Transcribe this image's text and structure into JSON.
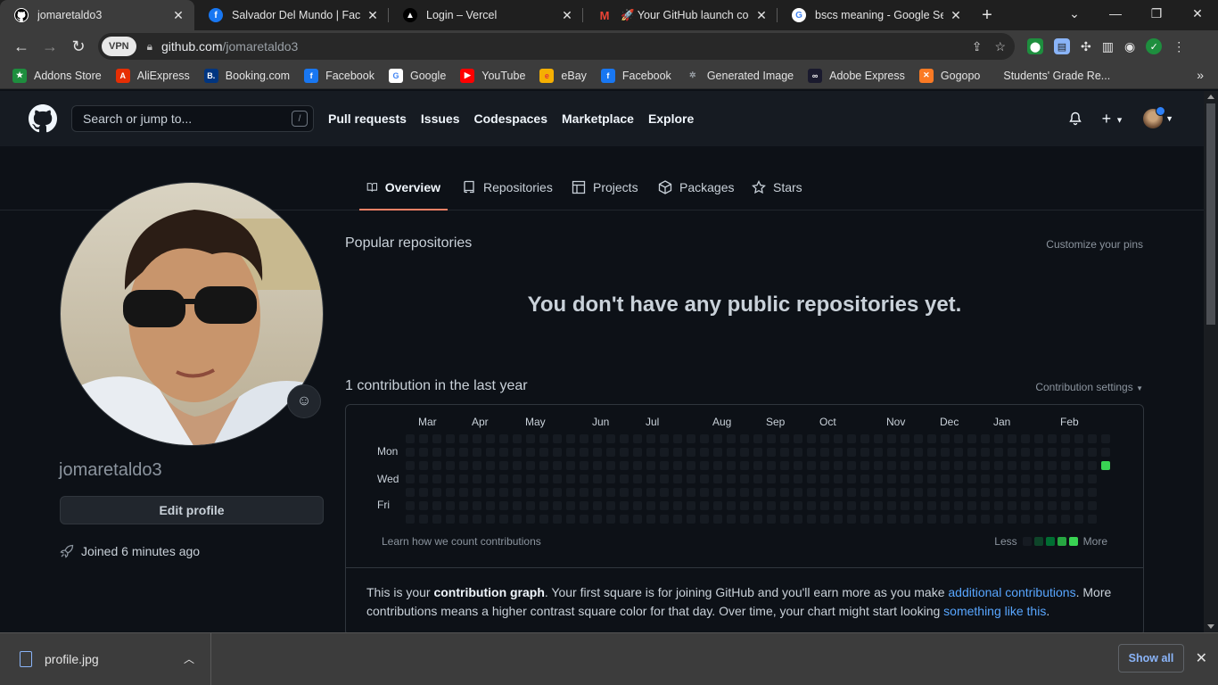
{
  "browser": {
    "tabs": [
      {
        "title": "jomaretaldo3",
        "icon": "github-icon"
      },
      {
        "title": "Salvador Del Mundo | Facebook",
        "icon": "facebook-icon"
      },
      {
        "title": "Login – Vercel",
        "icon": "vercel-icon"
      },
      {
        "title": "🚀 Your GitHub launch code",
        "icon": "gmail-icon"
      },
      {
        "title": "bscs meaning - Google Search",
        "icon": "google-icon"
      }
    ],
    "url_host": "github.com",
    "url_path": "/jomaretaldo3",
    "vpn_label": "VPN",
    "bookmarks": [
      {
        "label": "Addons Store",
        "icon": "addons-icon",
        "color": "#1e8e3e"
      },
      {
        "label": "AliExpress",
        "icon": "aliexpress-icon",
        "color": "#e62e04"
      },
      {
        "label": "Booking.com",
        "icon": "booking-icon",
        "color": "#003580"
      },
      {
        "label": "Facebook",
        "icon": "facebook-icon",
        "color": "#1877f2"
      },
      {
        "label": "Google",
        "icon": "google-icon",
        "color": "#ffffff"
      },
      {
        "label": "YouTube",
        "icon": "youtube-icon",
        "color": "#ff0000"
      },
      {
        "label": "eBay",
        "icon": "ebay-icon",
        "color": "#f5af02"
      },
      {
        "label": "Facebook",
        "icon": "facebook-icon",
        "color": "#1877f2"
      },
      {
        "label": "Generated Image",
        "icon": "openai-icon",
        "color": "#9aa0a6"
      },
      {
        "label": "Adobe Express",
        "icon": "adobe-icon",
        "color": "#1a1a2e"
      },
      {
        "label": "Gogopo",
        "icon": "xampp-icon",
        "color": "#fb7a24"
      },
      {
        "label": "Students' Grade Re...",
        "icon": "",
        "color": ""
      }
    ]
  },
  "github": {
    "search_placeholder": "Search or jump to...",
    "search_shortcut": "/",
    "nav": [
      "Pull requests",
      "Issues",
      "Codespaces",
      "Marketplace",
      "Explore"
    ],
    "profile_tabs": [
      {
        "label": "Overview",
        "icon": "book-icon"
      },
      {
        "label": "Repositories",
        "icon": "repo-icon"
      },
      {
        "label": "Projects",
        "icon": "table-icon"
      },
      {
        "label": "Packages",
        "icon": "package-icon"
      },
      {
        "label": "Stars",
        "icon": "star-icon"
      }
    ],
    "username": "jomaretaldo3",
    "edit_profile": "Edit profile",
    "joined": "Joined 6 minutes ago",
    "popular_title": "Popular repositories",
    "customize_pins": "Customize your pins",
    "no_repos": "You don't have any public repositories yet.",
    "contrib_title": "1 contribution in the last year",
    "contrib_settings": "Contribution settings",
    "months": [
      "Mar",
      "Apr",
      "May",
      "Jun",
      "Jul",
      "Aug",
      "Sep",
      "Oct",
      "Nov",
      "Dec",
      "Jan",
      "Feb"
    ],
    "days": [
      "Mon",
      "Wed",
      "Fri"
    ],
    "learn_link": "Learn how we count contributions",
    "legend_less": "Less",
    "legend_more": "More",
    "legend_colors": [
      "#161b22",
      "#0e4429",
      "#006d32",
      "#26a641",
      "#39d353"
    ],
    "graph_weeks": 53,
    "contribution_count": 1,
    "graph_text": {
      "p1": "This is your ",
      "p1_bold": "contribution graph",
      "p2": ". Your first square is for joining GitHub and you'll earn more as you make ",
      "link1": "additional contributions",
      "p3": ". More contributions means a higher contrast square color for that day. Over time, your chart might start looking ",
      "link2": "something like this",
      "p4": "."
    }
  },
  "downloads": {
    "file": "profile.jpg",
    "show_all": "Show all"
  }
}
